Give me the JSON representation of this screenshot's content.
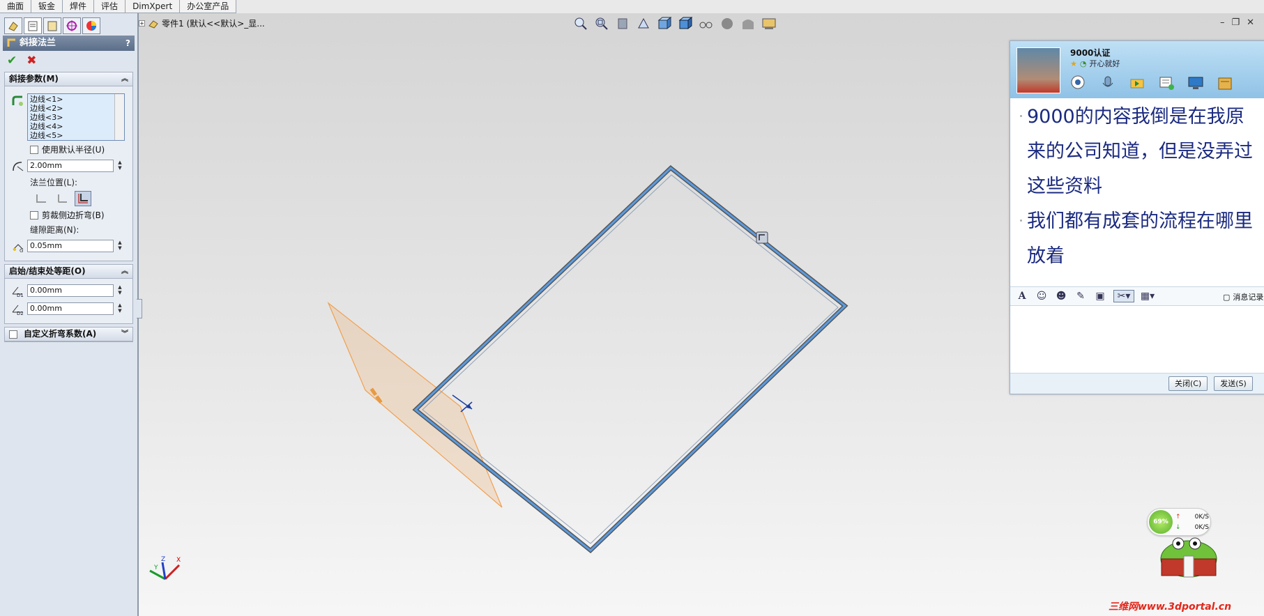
{
  "ribbon_tabs": [
    "曲面",
    "钣金",
    "焊件",
    "评估",
    "DimXpert",
    "办公室产品"
  ],
  "tree": {
    "label": "零件1  (默认<<默认>_显..."
  },
  "property_manager": {
    "title": "斜接法兰",
    "help": "?",
    "miter_params": {
      "title": "斜接参数(M)",
      "edges": [
        "边线<1>",
        "边线<2>",
        "边线<3>",
        "边线<4>",
        "边线<5>"
      ],
      "use_default_radius": "使用默认半径(U)",
      "radius": "2.00mm",
      "flange_position_label": "法兰位置(L):",
      "trim_side_bends": "剪裁侧边折弯(B)",
      "gap_label": "缝隙距离(N):",
      "gap": "0.05mm"
    },
    "offsets": {
      "title": "启始/结束处等距(O)",
      "d1_label": "D1",
      "d1": "0.00mm",
      "d2_label": "D2",
      "d2": "0.00mm"
    },
    "custom_bend": {
      "title": "自定义折弯系数(A)"
    }
  },
  "qq": {
    "name": "9000认证",
    "status": "开心就好",
    "messages": [
      "9000的内容我倒是在我原",
      "来的公司知道，但是没弄过",
      "这些资料",
      "我们都有成套的流程在哪里",
      "放着"
    ],
    "history_label": "消息记录",
    "close_label": "关闭(C)",
    "send_label": "发送(S)"
  },
  "netmon": {
    "percent": "69%",
    "up": "0K/S",
    "down": "0K/S"
  },
  "triad": {
    "x": "X",
    "y": "Y",
    "z": "Z"
  },
  "watermark": "三维网www.3dportal.cn",
  "colors": {
    "edge_blue": "#5b9be0",
    "plane_orange": "#f0a050",
    "accept_green": "#2a9a2a",
    "cancel_red": "#d02020"
  }
}
